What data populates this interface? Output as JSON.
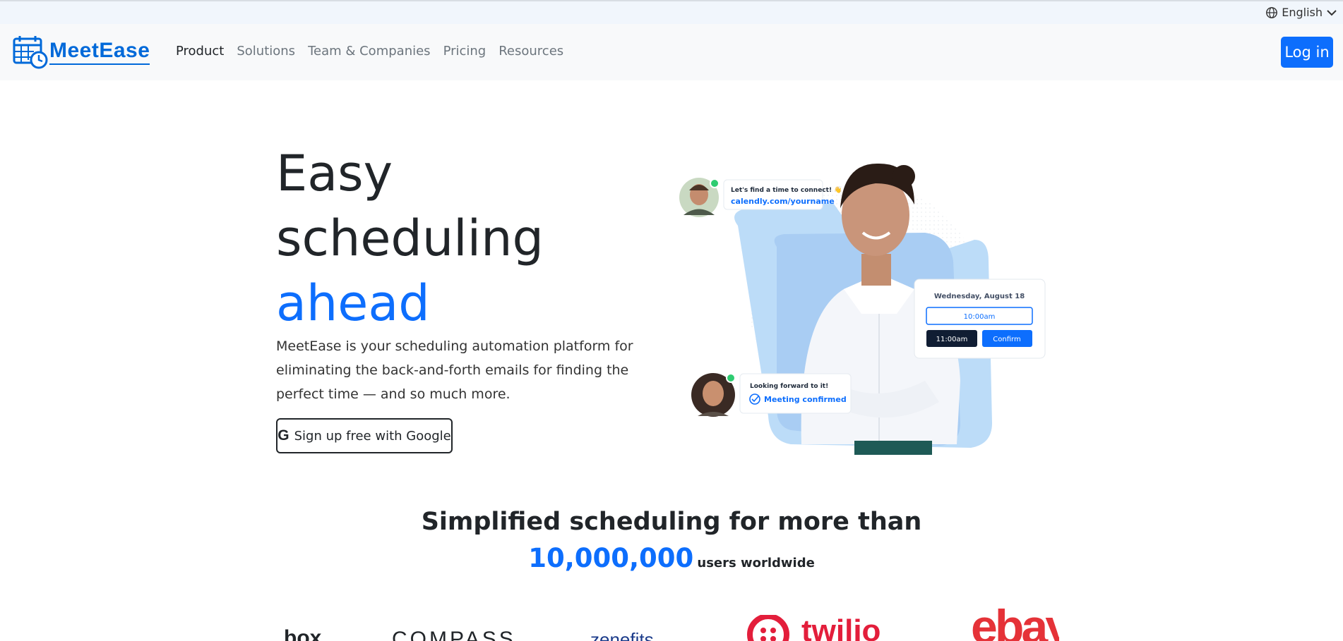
{
  "language": {
    "label": "English"
  },
  "brand": {
    "name": "MeetEase"
  },
  "nav": {
    "items": [
      "Product",
      "Solutions",
      "Team & Companies",
      "Pricing",
      "Resources"
    ],
    "login_label": "Log in"
  },
  "hero": {
    "title_line1": "Easy",
    "title_line2": "scheduling",
    "title_accent": "ahead",
    "description": "MeetEase is your scheduling automation platform for eliminating the back-and-forth emails for finding the perfect time — and so much more.",
    "google_button": "Sign up free with Google",
    "google_letter": "G"
  },
  "illustration": {
    "bubble1_line1": "Let's find a time to connect! 👋",
    "bubble1_link": "calendly.com/yourname",
    "card_date": "Wednesday, August 18",
    "slot1": "10:00am",
    "slot2": "11:00am",
    "confirm": "Confirm",
    "bubble2_line1": "Looking forward to it!",
    "bubble2_status": "Meeting confirmed"
  },
  "stats": {
    "title": "Simplified scheduling for more than",
    "count": "10,000,000",
    "count_label": "users worldwide"
  },
  "customer_logos": [
    "box",
    "COMPASS",
    "zenefits",
    "twilio",
    "ebay"
  ],
  "colors": {
    "accent": "#0d6efd",
    "brand": "#0069d9",
    "twilio": "#e31e3b"
  }
}
